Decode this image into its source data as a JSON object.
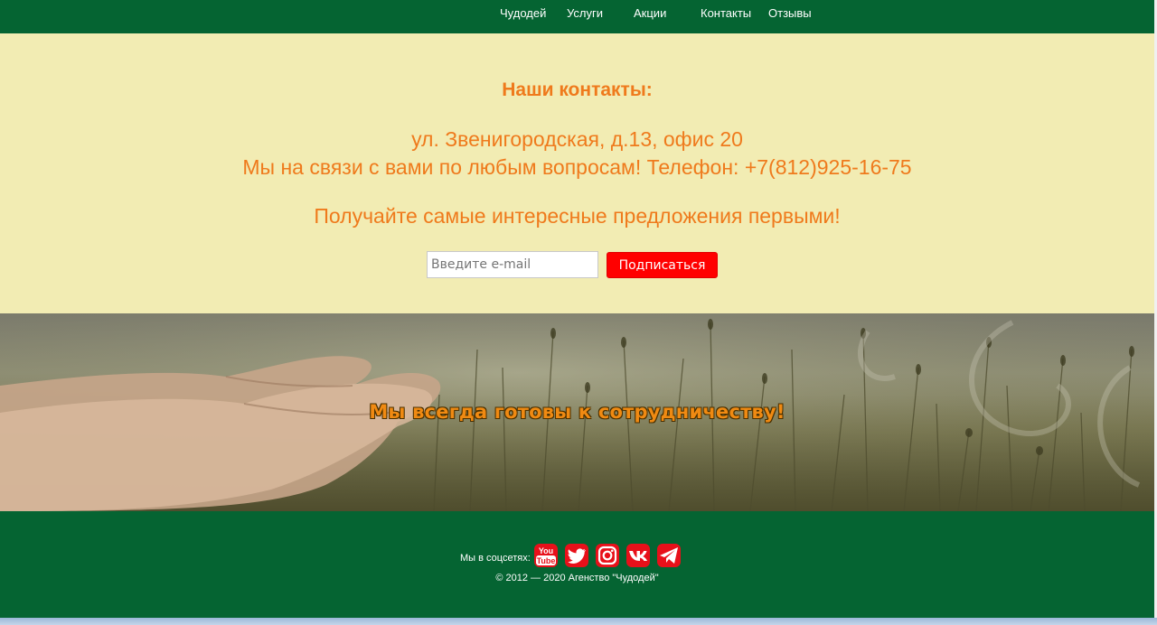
{
  "nav": {
    "items": [
      "Чудодей",
      "Услуги",
      "Акции",
      "Контакты",
      "Отзывы"
    ]
  },
  "contacts": {
    "title": "Наши контакты:",
    "address": "ул. Звенигородская, д.13, офис 20",
    "phone_line": "Мы на связи с вами по любым вопросам! Телефон: +7(812)925-16-75",
    "promo": "Получайте самые интересные предложения первыми!",
    "email_placeholder": "Введите e-mail",
    "subscribe_label": "Подписаться"
  },
  "banner": {
    "text": "Мы всегда готовы к сотрудничеству!"
  },
  "footer": {
    "social_label": "Мы в соцсетях:",
    "social_icons": [
      "youtube-icon",
      "twitter-icon",
      "instagram-icon",
      "vk-icon",
      "telegram-icon"
    ],
    "youtube_text_top": "You",
    "youtube_text_bottom": "Tube",
    "copyright": "© 2012 — 2020 Агенство \"Чудодей\""
  },
  "colors": {
    "nav_bg": "#056432",
    "contacts_bg": "#f2ecb3",
    "accent_orange": "#ef7a1c",
    "button_red": "#ff0000",
    "social_red": "#e8101a"
  }
}
